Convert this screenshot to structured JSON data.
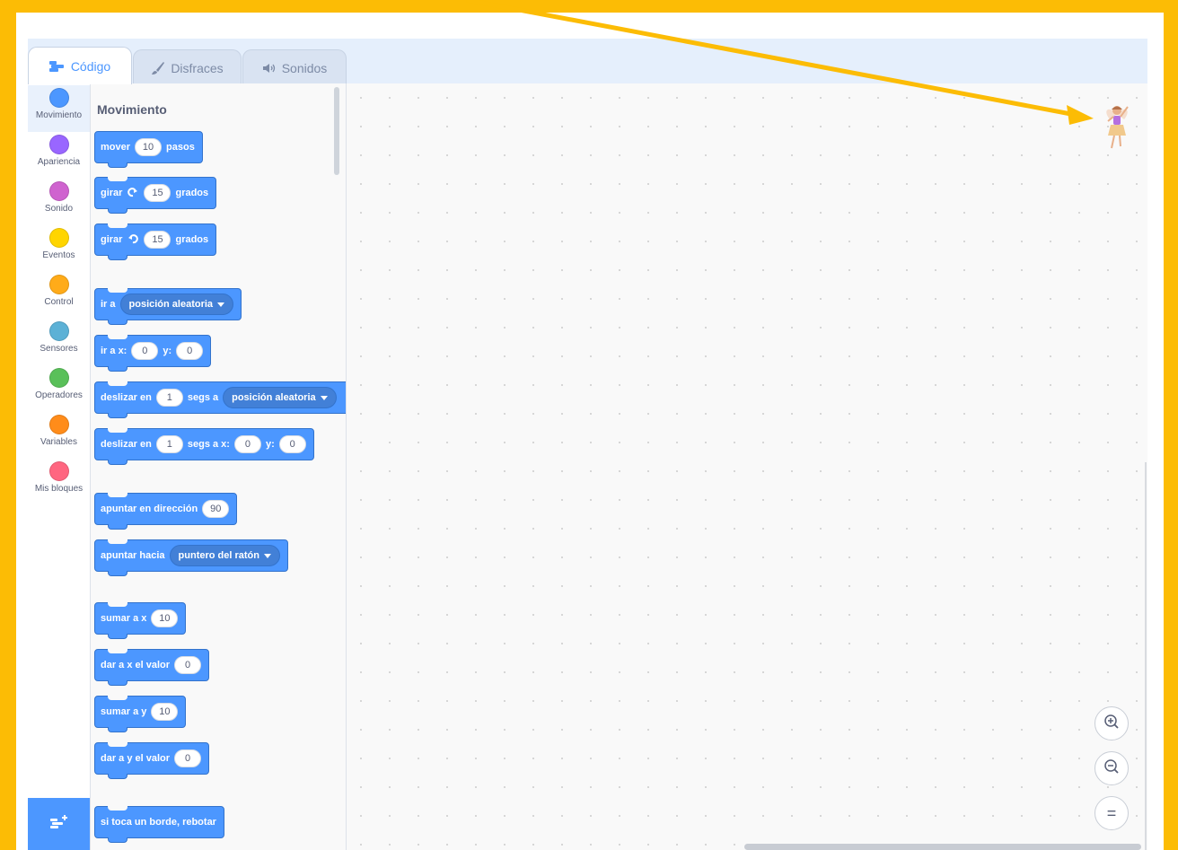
{
  "tabs": [
    {
      "label": "Código",
      "icon": "code-icon",
      "active": true
    },
    {
      "label": "Disfraces",
      "icon": "brush-icon",
      "active": false
    },
    {
      "label": "Sonidos",
      "icon": "speaker-icon",
      "active": false
    }
  ],
  "categories": [
    {
      "label": "Movimiento",
      "color": "#4c97ff"
    },
    {
      "label": "Apariencia",
      "color": "#9966ff"
    },
    {
      "label": "Sonido",
      "color": "#cf63cf"
    },
    {
      "label": "Eventos",
      "color": "#ffd500"
    },
    {
      "label": "Control",
      "color": "#ffab19"
    },
    {
      "label": "Sensores",
      "color": "#5cb1d6"
    },
    {
      "label": "Operadores",
      "color": "#59c059"
    },
    {
      "label": "Variables",
      "color": "#ff8c1a"
    },
    {
      "label": "Mis bloques",
      "color": "#ff6680"
    }
  ],
  "palette": {
    "title": "Movimiento",
    "blocks": {
      "move": {
        "a": "mover",
        "v": "10",
        "b": "pasos"
      },
      "turn_right": {
        "a": "girar",
        "v": "15",
        "b": "grados"
      },
      "turn_left": {
        "a": "girar",
        "v": "15",
        "b": "grados"
      },
      "goto": {
        "a": "ir a",
        "menu": "posición aleatoria"
      },
      "goto_xy": {
        "a": "ir a x:",
        "x": "0",
        "b": "y:",
        "y": "0"
      },
      "glide": {
        "a": "deslizar en",
        "v": "1",
        "b": "segs a",
        "menu": "posición aleatoria"
      },
      "glide_xy": {
        "a": "deslizar en",
        "v": "1",
        "b": "segs a x:",
        "x": "0",
        "c": "y:",
        "y": "0"
      },
      "point_dir": {
        "a": "apuntar en dirección",
        "v": "90"
      },
      "point_towards": {
        "a": "apuntar hacia",
        "menu": "puntero del ratón"
      },
      "change_x": {
        "a": "sumar a x",
        "v": "10"
      },
      "set_x": {
        "a": "dar a x el valor",
        "v": "0"
      },
      "change_y": {
        "a": "sumar a y",
        "v": "10"
      },
      "set_y": {
        "a": "dar a y el valor",
        "v": "0"
      },
      "bounce": {
        "a": "si toca un borde, rebotar"
      }
    }
  },
  "zoom_controls": {
    "zoom_in": "zoom-in-icon",
    "zoom_out": "zoom-out-icon",
    "reset": "="
  },
  "colors": {
    "accent": "#4c97ff",
    "frame": "#fcbc05",
    "motion_block": "#4c97ff"
  }
}
